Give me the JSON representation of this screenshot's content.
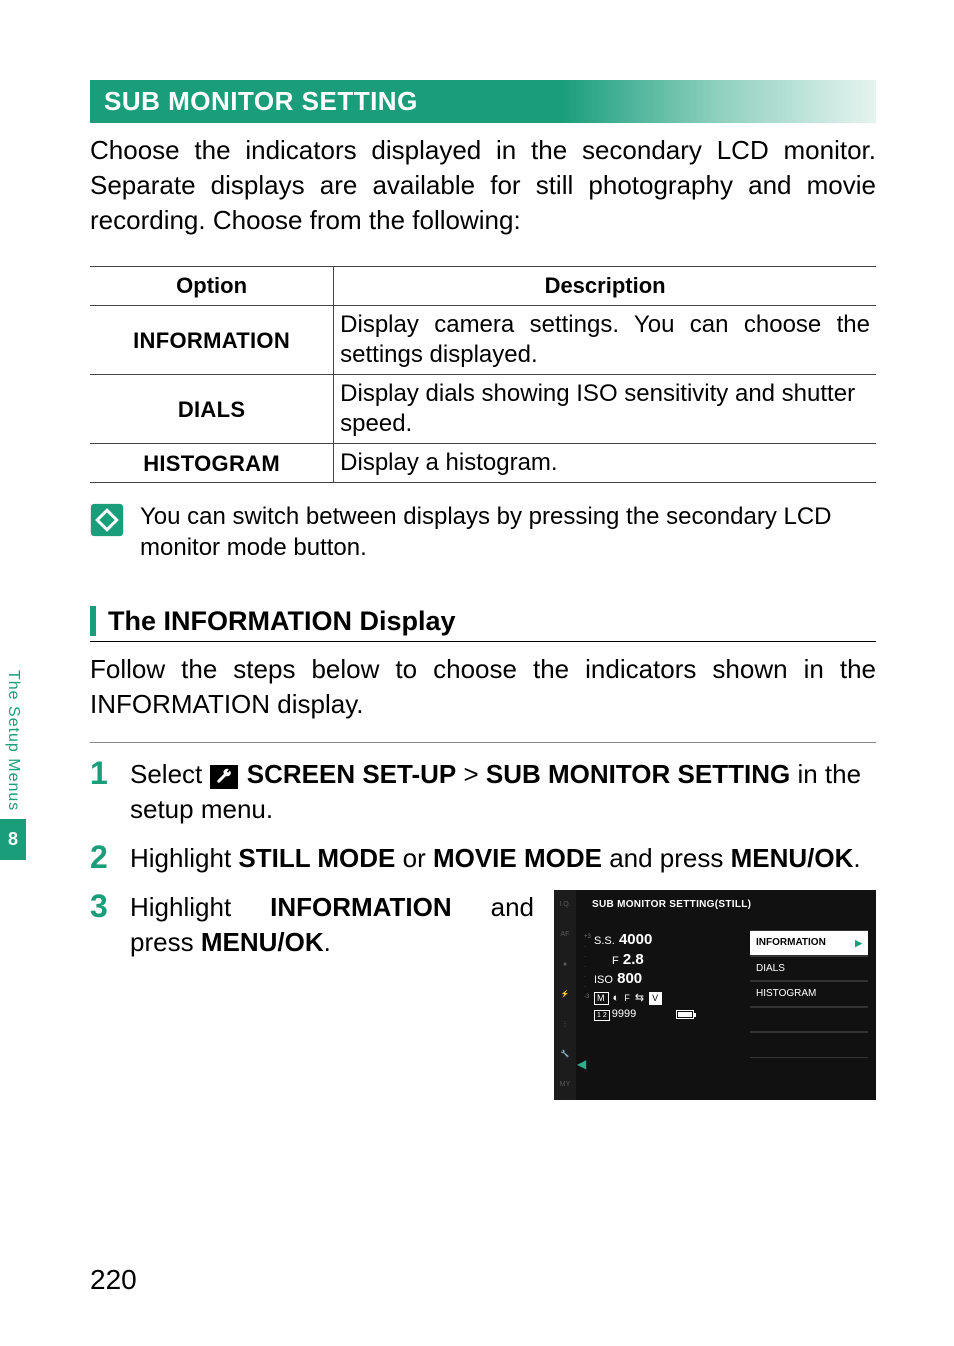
{
  "header": "SUB MONITOR SETTING",
  "intro": "Choose the indicators displayed in the secondary LCD monitor. Separate displays are available for still photography and movie recording. Choose from the following:",
  "table": {
    "head_option": "Option",
    "head_desc": "Description",
    "rows": [
      {
        "option": "INFORMATION",
        "desc": "Display camera settings. You can choose the settings displayed."
      },
      {
        "option": "DIALS",
        "desc": "Display dials showing ISO sensitivity and shutter speed."
      },
      {
        "option": "HISTOGRAM",
        "desc": "Display a histogram."
      }
    ]
  },
  "note": "You can switch between displays by pressing the secondary LCD monitor mode button.",
  "subheading": "The INFORMATION Display",
  "follow": "Follow the steps below to choose the indicators shown in the INFORMATION display.",
  "steps": {
    "s1_a": "Select ",
    "s1_b": "SCREEN SET-UP",
    "s1_c": " > ",
    "s1_d": "SUB MONITOR SETTING",
    "s1_e": " in the setup menu.",
    "s2_a": "Highlight ",
    "s2_b": "STILL MODE",
    "s2_c": " or ",
    "s2_d": "MOVIE MODE",
    "s2_e": " and press ",
    "s2_f": "MENU/OK",
    "s2_g": ".",
    "s3_a": "Highlight ",
    "s3_b": "INFORMATION",
    "s3_c": " and press ",
    "s3_d": "MENU/OK",
    "s3_e": "."
  },
  "cam": {
    "title": "SUB MONITOR SETTING(STILL)",
    "ss_label": "S.S.",
    "ss_val": "4000",
    "f_label": "F",
    "f_val": "2.8",
    "iso_label": "ISO",
    "iso_val": "800",
    "shots": "9999",
    "menu_information": "INFORMATION",
    "menu_dials": "DIALS",
    "menu_histogram": "HISTOGRAM",
    "side": {
      "iq": "I.Q.",
      "af": "AF",
      "mf": "MF",
      "flash": "⚡",
      "set": "⚙",
      "wrench": "🔧",
      "my": "MY"
    }
  },
  "side_label": "The Setup Menus",
  "side_num": "8",
  "page_number": "220"
}
